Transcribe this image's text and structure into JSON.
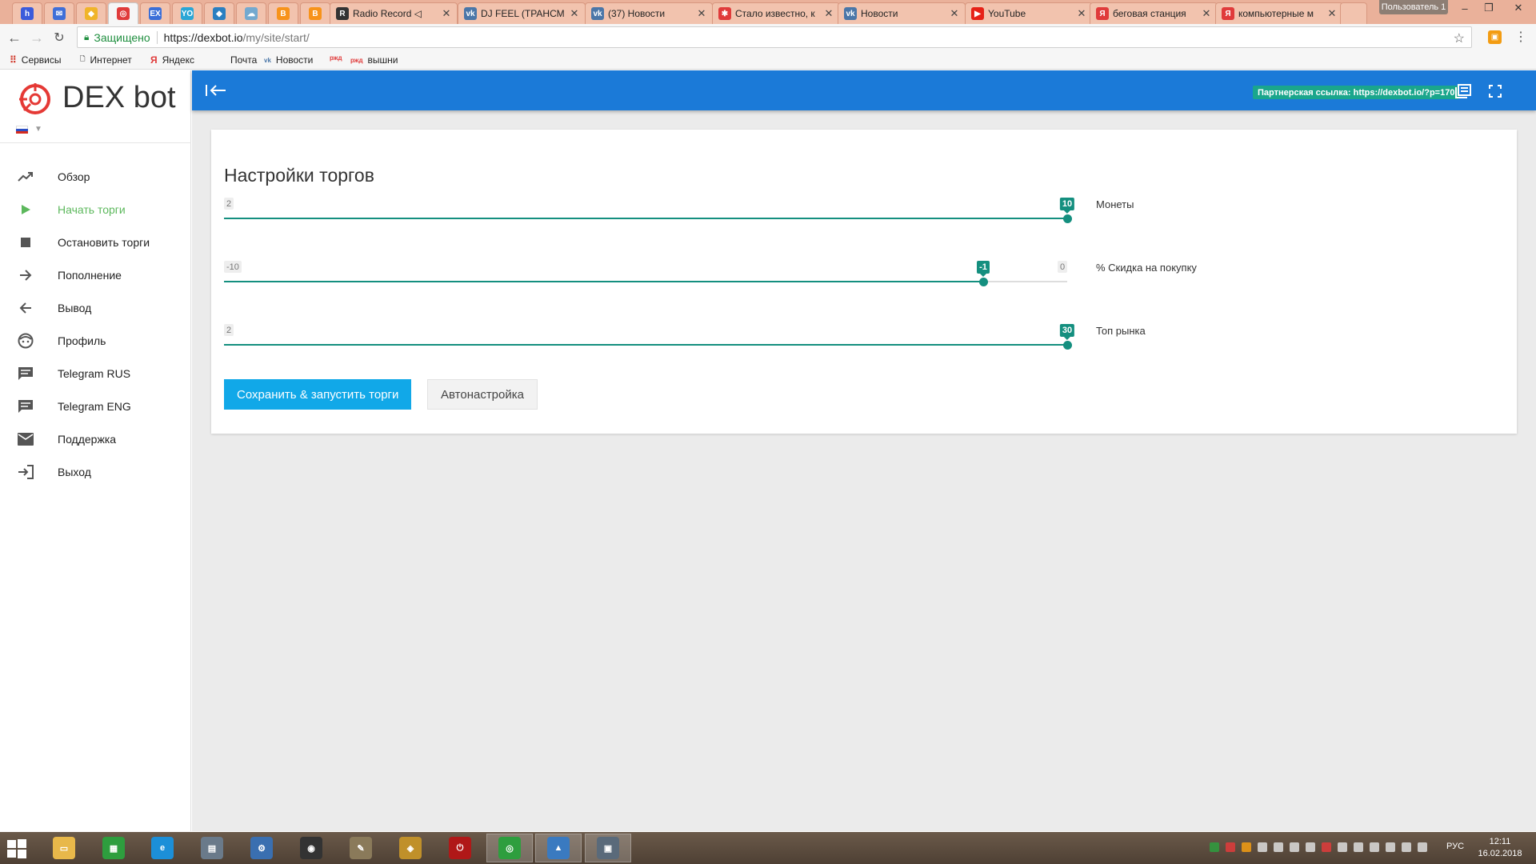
{
  "browser": {
    "tabs": [
      {
        "title": "",
        "icon": "pin-icon",
        "color": "#3b5bdb",
        "glyph": "h"
      },
      {
        "title": "",
        "icon": "mail-icon",
        "color": "#3f6fd8",
        "glyph": "✉"
      },
      {
        "title": "",
        "icon": "coin-icon",
        "color": "#f0b429",
        "glyph": "◆"
      },
      {
        "title": "",
        "icon": "dexbot-icon",
        "color": "#e03b3b",
        "glyph": "◎"
      },
      {
        "title": "",
        "icon": "ex-icon",
        "color": "#3b6fd8",
        "glyph": "EX"
      },
      {
        "title": "",
        "icon": "yo-icon",
        "color": "#2aa6d6",
        "glyph": "YO"
      },
      {
        "title": "",
        "icon": "diamond-icon",
        "color": "#2a7fc1",
        "glyph": "◆"
      },
      {
        "title": "",
        "icon": "cloud-icon",
        "color": "#74a9cf",
        "glyph": "☁"
      },
      {
        "title": "",
        "icon": "bitcoin-icon",
        "color": "#f7931a",
        "glyph": "B"
      },
      {
        "title": "",
        "icon": "bitcoin-icon",
        "color": "#f7931a",
        "glyph": "B"
      },
      {
        "title": "Radio Record ◁",
        "icon": "radio-icon",
        "color": "#333",
        "glyph": "R"
      },
      {
        "title": "DJ FEEL (ТРАНСМ",
        "icon": "vk-icon",
        "color": "#4a76a8",
        "glyph": "vk"
      },
      {
        "title": "(37) Новости",
        "icon": "vk-icon",
        "color": "#4a76a8",
        "glyph": "vk"
      },
      {
        "title": "Стало известно, к",
        "icon": "news-icon",
        "color": "#e03b3b",
        "glyph": "✱"
      },
      {
        "title": "Новости",
        "icon": "vk-icon",
        "color": "#4a76a8",
        "glyph": "vk"
      },
      {
        "title": "YouTube",
        "icon": "youtube-icon",
        "color": "#e62117",
        "glyph": "▶"
      },
      {
        "title": "беговая станция",
        "icon": "yandex-icon",
        "color": "#e03b3b",
        "glyph": "Я"
      },
      {
        "title": "компьютерные м",
        "icon": "yandex-icon",
        "color": "#e03b3b",
        "glyph": "Я"
      }
    ],
    "user_badge": "Пользователь 1",
    "secure_label": "Защищено",
    "url_host": "https://dexbot.io",
    "url_path": "/my/site/start/",
    "bookmarks": [
      {
        "label": "Сервисы",
        "icon": "apps-icon",
        "glyph": "⠿",
        "color": "#d23f31"
      },
      {
        "label": "Интернет",
        "icon": "page-icon",
        "glyph": "🗋",
        "color": "#666"
      },
      {
        "label": "Яндекс",
        "icon": "yandex-icon",
        "glyph": "Я",
        "color": "#e03b3b"
      },
      {
        "label": "Почта",
        "icon": "blank-icon",
        "glyph": "",
        "color": "#666"
      },
      {
        "label": "Новости",
        "icon": "vk-icon",
        "glyph": "vk",
        "color": "#4a76a8"
      },
      {
        "label": "",
        "icon": "rzd-icon",
        "glyph": "ржд",
        "color": "#e03b3b"
      },
      {
        "label": "вышни",
        "icon": "rzd-icon",
        "glyph": "ржд",
        "color": "#e03b3b"
      }
    ]
  },
  "sidebar": {
    "logo_text": "DEX bot",
    "language": "ru",
    "items": [
      {
        "label": "Обзор",
        "icon": "trending-up-icon",
        "active": false
      },
      {
        "label": "Начать торги",
        "icon": "play-icon",
        "active": true
      },
      {
        "label": "Остановить торги",
        "icon": "stop-icon",
        "active": false
      },
      {
        "label": "Пополнение",
        "icon": "arrow-right-icon",
        "active": false
      },
      {
        "label": "Вывод",
        "icon": "arrow-left-icon",
        "active": false
      },
      {
        "label": "Профиль",
        "icon": "face-icon",
        "active": false
      },
      {
        "label": "Telegram RUS",
        "icon": "chat-icon",
        "active": false
      },
      {
        "label": "Telegram ENG",
        "icon": "chat-icon",
        "active": false
      },
      {
        "label": "Поддержка",
        "icon": "mail-icon",
        "active": false
      },
      {
        "label": "Выход",
        "icon": "logout-icon",
        "active": false
      }
    ]
  },
  "topbar": {
    "partner_link": "Партнерская ссылка: https://dexbot.io/?p=170"
  },
  "settings": {
    "title": "Настройки торгов",
    "sliders": [
      {
        "label": "Монеты",
        "min": 2,
        "max": 10,
        "value": 10,
        "show_max": false
      },
      {
        "label": "% Скидка на покупку",
        "min": -10,
        "max": 0,
        "value": -1,
        "show_max": true
      },
      {
        "label": "Топ рынка",
        "min": 2,
        "max": 30,
        "value": 30,
        "show_max": false
      }
    ],
    "save_button": "Сохранить & запустить торги",
    "auto_button": "Автонастройка"
  },
  "taskbar": {
    "language": "РУС",
    "time": "12:11",
    "date": "16.02.2018"
  },
  "colors": {
    "accent": "#1b7ad8",
    "slider": "#148f7f",
    "primary_button": "#11a8e8",
    "active_menu": "#5cb85c"
  }
}
